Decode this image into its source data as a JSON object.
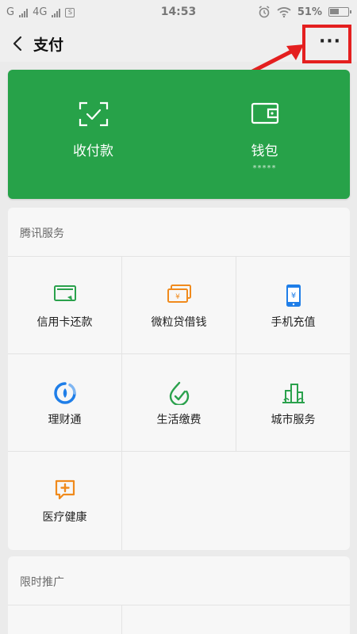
{
  "status_bar": {
    "carrier1": "G",
    "carrier2": "4G",
    "box_icon_char": "S",
    "time": "14:53",
    "battery": "51%"
  },
  "header": {
    "title": "支付",
    "more_label": "···"
  },
  "pay_card": {
    "receive_pay_label": "收付款",
    "wallet_label": "钱包",
    "wallet_balance_mask": "*****",
    "color": "#27a249"
  },
  "tencent_services": {
    "title": "腾讯服务",
    "items": [
      {
        "label": "信用卡还款",
        "icon": "credit-card-icon"
      },
      {
        "label": "微粒贷借钱",
        "icon": "loan-icon"
      },
      {
        "label": "手机充值",
        "icon": "phone-recharge-icon"
      },
      {
        "label": "理财通",
        "icon": "wealth-icon"
      },
      {
        "label": "生活缴费",
        "icon": "utility-icon"
      },
      {
        "label": "城市服务",
        "icon": "city-icon"
      },
      {
        "label": "医疗健康",
        "icon": "medical-icon"
      }
    ]
  },
  "promotions": {
    "title": "限时推广"
  },
  "annotation": {
    "highlight_color": "#e41f1f"
  }
}
